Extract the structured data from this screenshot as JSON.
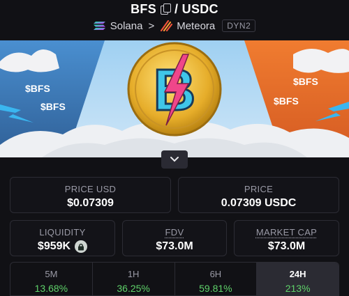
{
  "header": {
    "title": "BFS / USDC",
    "title_base": "BFS",
    "title_sep": "/",
    "title_quote": "USDC",
    "chain": "Solana",
    "dex": "Meteora",
    "pool_type": "DYN2"
  },
  "banner": {
    "ticker_labels": [
      "$BFS",
      "$BFS",
      "$BFS",
      "$BFS"
    ],
    "coin_mark": "B"
  },
  "stats": {
    "price_usd": {
      "label": "PRICE USD",
      "value": "$0.07309"
    },
    "price": {
      "label": "PRICE",
      "value": "0.07309 USDC"
    },
    "liquidity": {
      "label": "LIQUIDITY",
      "value": "$959K"
    },
    "fdv": {
      "label": "FDV",
      "value": "$73.0M"
    },
    "market_cap": {
      "label": "MARKET CAP",
      "value": "$73.0M"
    }
  },
  "timeframes": [
    {
      "label": "5M",
      "value": "13.68%"
    },
    {
      "label": "1H",
      "value": "36.25%"
    },
    {
      "label": "6H",
      "value": "59.81%"
    },
    {
      "label": "24H",
      "value": "213%"
    }
  ],
  "colors": {
    "background": "#111115",
    "positive": "#5fd26a",
    "banner_left": "#3c6fa8",
    "banner_right": "#e8722e",
    "coin_gold": "#e9b830",
    "coin_blue": "#3fc6e8",
    "coin_pink": "#f0468a"
  },
  "icons": {
    "copy": "copy-icon",
    "chain": "solana-icon",
    "separator": "chevron-right-icon",
    "dex": "meteora-icon",
    "expand": "chevron-down-icon",
    "lock": "lock-icon"
  }
}
